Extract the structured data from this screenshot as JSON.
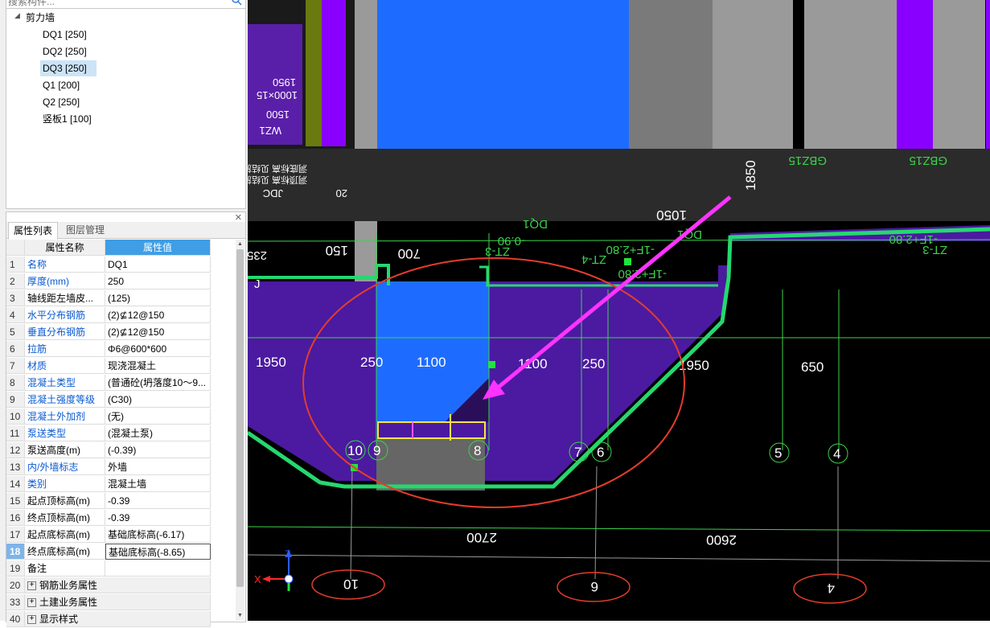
{
  "search": {
    "placeholder": "搜索构件..."
  },
  "tree": {
    "root": "剪力墙",
    "items": [
      "DQ1 [250]",
      "DQ2 [250]",
      "DQ3 [250]",
      "Q1 [200]",
      "Q2 [250]",
      "竖板1 [100]"
    ],
    "selected_index": 2
  },
  "tabs": [
    "属性列表",
    "图层管理"
  ],
  "props": {
    "header": {
      "num": "",
      "name": "属性名称",
      "value": "属性值"
    },
    "rows": [
      {
        "num": "1",
        "name": "名称",
        "value": "DQ1",
        "blue": true
      },
      {
        "num": "2",
        "name": "厚度(mm)",
        "value": "250",
        "blue": true
      },
      {
        "num": "3",
        "name": "轴线距左墙皮...",
        "value": "(125)",
        "blue": false
      },
      {
        "num": "4",
        "name": "水平分布钢筋",
        "value": "(2)⊈12@150",
        "blue": true
      },
      {
        "num": "5",
        "name": "垂直分布钢筋",
        "value": "(2)⊈12@150",
        "blue": true
      },
      {
        "num": "6",
        "name": "拉筋",
        "value": "Φ6@600*600",
        "blue": true
      },
      {
        "num": "7",
        "name": "材质",
        "value": "现浇混凝土",
        "blue": true
      },
      {
        "num": "8",
        "name": "混凝土类型",
        "value": "(普通砼(坍落度10～9...",
        "blue": true
      },
      {
        "num": "9",
        "name": "混凝土强度等级",
        "value": "(C30)",
        "blue": true
      },
      {
        "num": "10",
        "name": "混凝土外加剂",
        "value": "(无)",
        "blue": true
      },
      {
        "num": "11",
        "name": "泵送类型",
        "value": "(混凝土泵)",
        "blue": true
      },
      {
        "num": "12",
        "name": "泵送高度(m)",
        "value": "(-0.39)",
        "blue": false
      },
      {
        "num": "13",
        "name": "内/外墙标志",
        "value": "外墙",
        "blue": true
      },
      {
        "num": "14",
        "name": "类别",
        "value": "混凝土墙",
        "blue": true
      },
      {
        "num": "15",
        "name": "起点顶标高(m)",
        "value": "-0.39",
        "blue": false
      },
      {
        "num": "16",
        "name": "终点顶标高(m)",
        "value": "-0.39",
        "blue": false
      },
      {
        "num": "17",
        "name": "起点底标高(m)",
        "value": "基础底标高(-6.17)",
        "blue": false
      },
      {
        "num": "18",
        "name": "终点底标高(m)",
        "value": "基础底标高(-8.65)",
        "blue": false
      },
      {
        "num": "19",
        "name": "备注",
        "value": "",
        "blue": false
      },
      {
        "num": "20",
        "name": "钢筋业务属性",
        "value": "",
        "blue": false,
        "group": true
      },
      {
        "num": "33",
        "name": "土建业务属性",
        "value": "",
        "blue": false,
        "group": true
      },
      {
        "num": "40",
        "name": "显示样式",
        "value": "",
        "blue": false,
        "group": true
      }
    ],
    "selected_row": 17
  },
  "canvas": {
    "dimensions": [
      "1950",
      "250",
      "1100",
      "1100",
      "250",
      "1950",
      "650"
    ],
    "axes": [
      "10",
      "9",
      "8",
      "7",
      "6",
      "5",
      "4"
    ],
    "axis_bubbles": [
      "10",
      "6",
      "4"
    ],
    "labels_top": [
      "150",
      "700",
      "1050",
      "1850"
    ],
    "labels_bottom": [
      "2700",
      "2600"
    ],
    "tags": [
      "DQ1",
      "DQ1",
      "-0.90",
      "ZT-3",
      "-1F+2.80",
      "-1F+2.80",
      "ZT-4",
      "ZT-3",
      "-1F+2.80",
      "GBZ15",
      "GBZ15",
      "J",
      "235"
    ],
    "mirrored_text": [
      "1950",
      "1000×15",
      "1500",
      "WZ1",
      "JDC",
      "20",
      "洞底标高 见结施",
      "洞顶标高 见结施"
    ],
    "triad": {
      "x": "X",
      "z": "Z"
    }
  },
  "colors": {
    "accent": "#3f9ee5",
    "wall_blue": "#1e6cff",
    "slab_purple": "#5a1fa8",
    "highlight_circle": "#e43c2c",
    "arrow": "#ff33ff"
  }
}
